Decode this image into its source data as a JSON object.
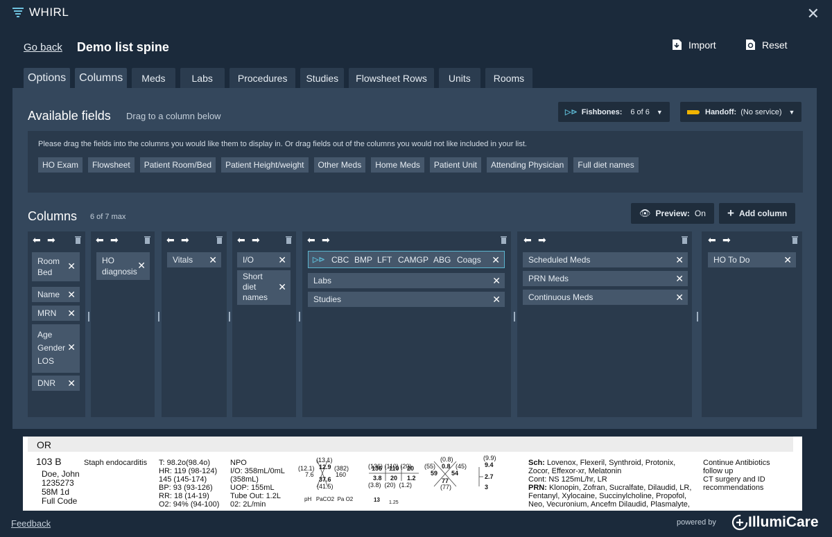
{
  "app": {
    "name": "WHIRL"
  },
  "header": {
    "go_back": "Go back",
    "title": "Demo list spine",
    "import_label": "Import",
    "reset_label": "Reset"
  },
  "tabs": [
    "Options",
    "Columns",
    "Meds",
    "Labs",
    "Procedures",
    "Studies",
    "Flowsheet Rows",
    "Units",
    "Rooms"
  ],
  "available_fields": {
    "title": "Available fields",
    "hint": "Drag to a column below",
    "fishbones": {
      "label": "Fishbones:",
      "value": "6 of 6"
    },
    "handoff": {
      "label": "Handoff:",
      "value": "(No service)"
    },
    "instruction": "Please drag the fields into the columns you would like them to display in. Or drag fields out of the columns you would not like included in your list.",
    "chips": [
      "HO Exam",
      "Flowsheet",
      "Patient Room/Bed",
      "Patient Height/weight",
      "Other Meds",
      "Home Meds",
      "Patient Unit",
      "Attending Physician",
      "Full diet names"
    ]
  },
  "columns_section": {
    "title": "Columns",
    "count": "6 of 7 max",
    "preview_label": "Preview:",
    "preview_value": "On",
    "add_column": "Add column",
    "col1": [
      "Room\nBed",
      "Name",
      "MRN",
      "Age\nGender\nLOS",
      "DNR"
    ],
    "col2": [
      "HO\ndiagnosis"
    ],
    "col3": [
      "Vitals"
    ],
    "col4": [
      "I/O",
      "Short\ndiet\nnames"
    ],
    "col5_fishbones": [
      "CBC",
      "BMP",
      "LFT",
      "CAMGP",
      "ABG",
      "Coags"
    ],
    "col5": [
      "Labs",
      "Studies"
    ],
    "col6": [
      "Scheduled Meds",
      "PRN Meds",
      "Continuous Meds"
    ],
    "col7": [
      "HO To Do"
    ]
  },
  "preview": {
    "section": "OR",
    "room": "103 B",
    "patient": "Doe, John\n1235273\n58M  1d\nFull Code",
    "diagnosis": "Staph endocarditis",
    "vitals": "T: 98.2o(98.4o)\nHR: 119 (98-124)\n        145 (145-174)\nBP: 93 (93-126)\nRR: 18 (14-19)\nO2: 94% (94-100)",
    "io": "NPO\nI/O: 358mL/0mL\n(358mL)\nUOP: 155mL\nTube Out: 1.2L\n02: 2L/min",
    "cbc": {
      "wbc": "7.6",
      "hgb": "12.9",
      "hct": "37.6",
      "plt": "160",
      "prev_wbc": "(12.1)",
      "prev_hgb": "(13.1)",
      "prev_hct": "(41.5)",
      "prev_plt": "(382)"
    },
    "bmp": {
      "na": "136",
      "cl": "110",
      "bun": "20",
      "k": "3.8",
      "co2": "20",
      "cr": "1.2",
      "prev": "(136) (110) (20)\n(3.8)  (20)  (1.2)"
    },
    "lft": {
      "top": "(0.8)",
      "mid": "0.8",
      "left": "59",
      "right": "54",
      "bottom": "77",
      "prev_l": "(55)",
      "prev_r": "(45)",
      "prev_b": "(77)"
    },
    "camgp": {
      "ca": "9.4",
      "mg": "2.7",
      "p": "3",
      "prev": "(9.9)"
    },
    "abg": {
      "labels": "pH   PaCO2  Pa O2",
      "vals": "13",
      "extra": "1.25"
    },
    "meds": {
      "sch_label": "Sch:",
      "sch": " Lovenox, Flexeril, Synthroid, Protonix,\nZocor, Effexor-xr, Melatonin\nCont: NS 125mL/hr, LR",
      "prn_label": "PRN:",
      "prn": " Klonopin, Zofran, Sucralfate, Dilaudid, LR,\nFentanyl, Xylocaine, Succinylcholine, Propofol,\nNeo, Vecuronium, Ancefm Dilaudid, Plasmalyte,"
    },
    "todo": "Continue Antibiotics\nfollow up\nCT surgery and ID\nrecommendations"
  },
  "footer": {
    "feedback": "Feedback",
    "powered_by": "powered by",
    "brand": "IllumiCare"
  }
}
